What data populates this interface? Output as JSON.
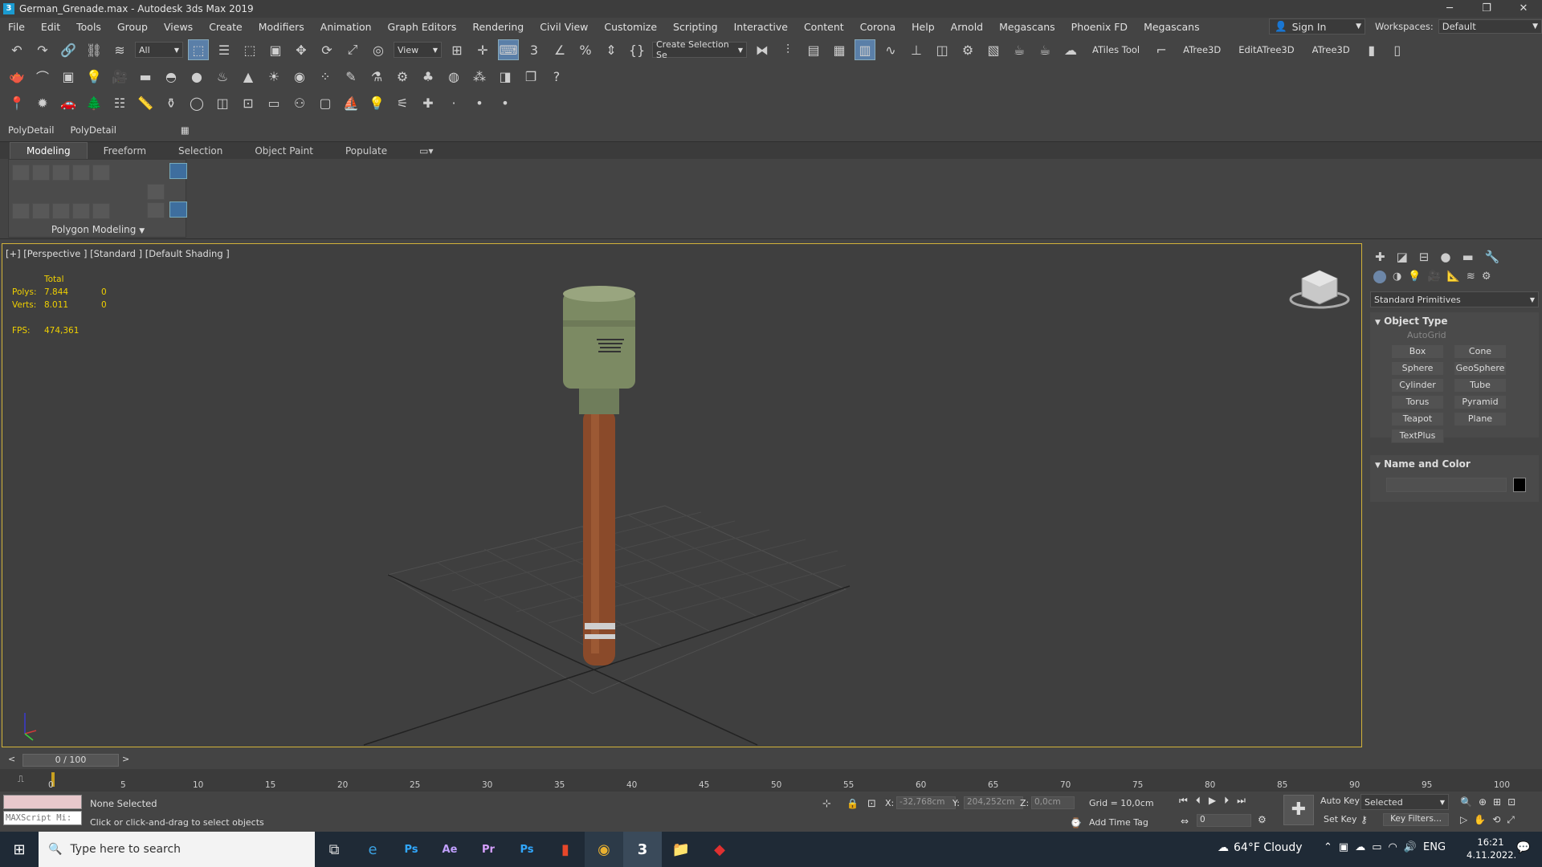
{
  "window": {
    "title": "German_Grenade.max - Autodesk 3ds Max 2019",
    "app_icon": "3",
    "minimize": "─",
    "restore": "❐",
    "close": "✕"
  },
  "menu": [
    "File",
    "Edit",
    "Tools",
    "Group",
    "Views",
    "Create",
    "Modifiers",
    "Animation",
    "Graph Editors",
    "Rendering",
    "Civil View",
    "Customize",
    "Scripting",
    "Interactive",
    "Content",
    "Corona",
    "Help",
    "Arnold",
    "Megascans",
    "Phoenix FD",
    "Megascans"
  ],
  "signin": {
    "label": "Sign In"
  },
  "workspace": {
    "label": "Workspaces:",
    "value": "Default"
  },
  "toolbar1": {
    "filter": "All",
    "ref_coord": "View",
    "named_selection": "Create Selection Se",
    "atiles": "ATiles Tool",
    "atree1": "ATree3D",
    "edit_atree": "EditATree3D",
    "atree2": "ATree3D"
  },
  "shelf": {
    "items": [
      "PolyDetail",
      "PolyDetail"
    ]
  },
  "ribbon": {
    "tabs": [
      "Modeling",
      "Freeform",
      "Selection",
      "Object Paint",
      "Populate"
    ],
    "active_tab": "Modeling",
    "panel_label": "Polygon Modeling"
  },
  "viewport": {
    "label": "[+] [Perspective ] [Standard ] [Default Shading ]",
    "stats": {
      "header": "Total",
      "polys_label": "Polys:",
      "polys_value": "7.844",
      "polys_sel": "0",
      "verts_label": "Verts:",
      "verts_value": "8.011",
      "verts_sel": "0",
      "fps_label": "FPS:",
      "fps_value": "474,361"
    }
  },
  "command_panel": {
    "category": "Standard Primitives",
    "rollout1": "Object Type",
    "autogrid": "AutoGrid",
    "buttons": [
      "Box",
      "Cone",
      "Sphere",
      "GeoSphere",
      "Cylinder",
      "Tube",
      "Torus",
      "Pyramid",
      "Teapot",
      "Plane",
      "TextPlus"
    ],
    "rollout2": "Name and Color",
    "object_color": "#000000"
  },
  "timeslider": {
    "label": "0 / 100",
    "prev": "<",
    "next": ">"
  },
  "trackbar": {
    "ticks": [
      "0",
      "5",
      "10",
      "15",
      "20",
      "25",
      "30",
      "35",
      "40",
      "45",
      "50",
      "55",
      "60",
      "65",
      "70",
      "75",
      "80",
      "85",
      "90",
      "95",
      "100"
    ]
  },
  "status": {
    "maxscript": "MAXScript Mi:",
    "selection": "None Selected",
    "prompt": "Click or click-and-drag to select objects",
    "x_label": "X:",
    "x_value": "-32,768cm",
    "y_label": "Y:",
    "y_value": "204,252cm",
    "z_label": "Z:",
    "z_value": "0,0cm",
    "grid": "Grid = 10,0cm",
    "add_time_tag": "Add Time Tag",
    "auto_key": "Auto Key",
    "key_mode": "Selected",
    "set_key": "Set Key",
    "key_filters": "Key Filters...",
    "frame": "0"
  },
  "taskbar": {
    "search_placeholder": "Type here to search",
    "weather": "64°F  Cloudy",
    "lang": "ENG",
    "time": "16:21",
    "date": "4.11.2022."
  }
}
